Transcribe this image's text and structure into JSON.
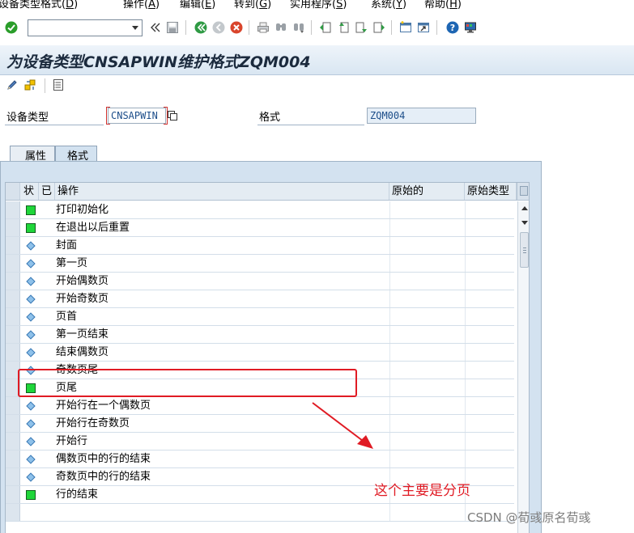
{
  "menubar": {
    "items": [
      {
        "label": "设备类型格式(",
        "accel": "D",
        "tail": ")"
      },
      {
        "label": "操作(",
        "accel": "A",
        "tail": ")"
      },
      {
        "label": "编辑(",
        "accel": "E",
        "tail": ")"
      },
      {
        "label": "转到(",
        "accel": "G",
        "tail": ")"
      },
      {
        "label": "实用程序(",
        "accel": "S",
        "tail": ")"
      },
      {
        "label": "系统(",
        "accel": "Y",
        "tail": ")"
      },
      {
        "label": "帮助(",
        "accel": "H",
        "tail": ")"
      }
    ]
  },
  "toolbar": {
    "command_value": "",
    "icons": [
      "enter-check-icon",
      "save-icon",
      "back-icon",
      "exit-icon",
      "cancel-icon",
      "print-icon",
      "find-icon",
      "find-next-icon",
      "first-page-icon",
      "previous-page-icon",
      "next-page-icon",
      "last-page-icon",
      "create-session-icon",
      "shortcut-icon",
      "help-icon",
      "customize-layout-icon"
    ],
    "colors": {
      "check": "#2a9d2a",
      "cancel": "#d9452c",
      "help": "#1e66b3"
    }
  },
  "title": "为设备类型CNSAPWIN维护格式ZQM004",
  "app_toolbar": {
    "icons": [
      "edit-pencil-icon",
      "display-change-icon",
      "details-icon"
    ]
  },
  "header": {
    "device_type_label": "设备类型",
    "device_type_value": "CNSAPWIN",
    "format_label": "格式",
    "format_value": "ZQM004"
  },
  "tabs": [
    {
      "label": "属性",
      "active": false
    },
    {
      "label": "格式",
      "active": true
    }
  ],
  "table": {
    "columns": [
      "状",
      "已",
      "操作",
      "原始的",
      "原始类型"
    ],
    "rows": [
      {
        "status": "green",
        "name": "打印初始化"
      },
      {
        "status": "green",
        "name": "在退出以后重置"
      },
      {
        "status": "diamond",
        "name": "封面"
      },
      {
        "status": "diamond",
        "name": "第一页"
      },
      {
        "status": "diamond",
        "name": "开始偶数页"
      },
      {
        "status": "diamond",
        "name": "开始奇数页"
      },
      {
        "status": "diamond",
        "name": "页首"
      },
      {
        "status": "diamond",
        "name": "第一页结束"
      },
      {
        "status": "diamond",
        "name": "结束偶数页"
      },
      {
        "status": "diamond",
        "name": "奇数页尾"
      },
      {
        "status": "green",
        "name": "页尾"
      },
      {
        "status": "diamond",
        "name": "开始行在一个偶数页"
      },
      {
        "status": "diamond",
        "name": "开始行在奇数页"
      },
      {
        "status": "diamond",
        "name": "开始行"
      },
      {
        "status": "diamond",
        "name": "偶数页中的行的结束"
      },
      {
        "status": "diamond",
        "name": "奇数页中的行的结束"
      },
      {
        "status": "green",
        "name": "行的结束"
      },
      {
        "status": "none",
        "name": ""
      }
    ],
    "status_colors": {
      "green": "#1fd63a",
      "diamond": "#8ec1ea"
    }
  },
  "annotation": {
    "text": "这个主要是分页",
    "color": "#e01b24"
  },
  "watermark": "CSDN @荀彧原名荀彧"
}
